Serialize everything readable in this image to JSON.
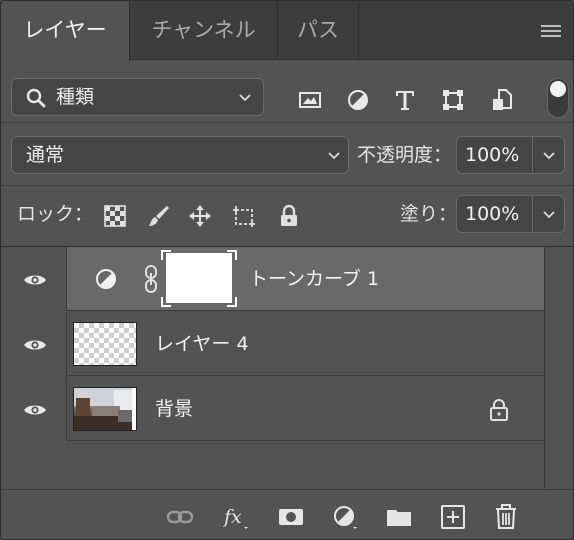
{
  "tabs": [
    {
      "label": "レイヤー",
      "active": true
    },
    {
      "label": "チャンネル",
      "active": false
    },
    {
      "label": "パス",
      "active": false
    }
  ],
  "filter": {
    "label": "種類",
    "icons": [
      "image-filter-icon",
      "adjustment-filter-icon",
      "type-filter-icon",
      "shape-filter-icon",
      "smart-object-filter-icon"
    ]
  },
  "blend": {
    "mode": "通常",
    "opacity_label": "不透明度：",
    "opacity_value": "100%"
  },
  "lock": {
    "label": "ロック：",
    "fill_label": "塗り：",
    "fill_value": "100%"
  },
  "layers": [
    {
      "name": "トーンカーブ 1",
      "type": "adjustment",
      "selected": true,
      "visible": true
    },
    {
      "name": "レイヤー 4",
      "type": "pixel",
      "selected": false,
      "visible": true
    },
    {
      "name": "背景",
      "type": "background",
      "selected": false,
      "visible": true,
      "locked": true
    }
  ],
  "bottom_toolbar": [
    "link-layers-icon",
    "fx-icon",
    "add-mask-icon",
    "adjustment-layer-icon",
    "group-folder-icon",
    "new-layer-icon",
    "trash-icon"
  ],
  "colors": {
    "panel": "#535353",
    "selected_row": "#696969",
    "tab_bar": "#3d3d3d"
  }
}
